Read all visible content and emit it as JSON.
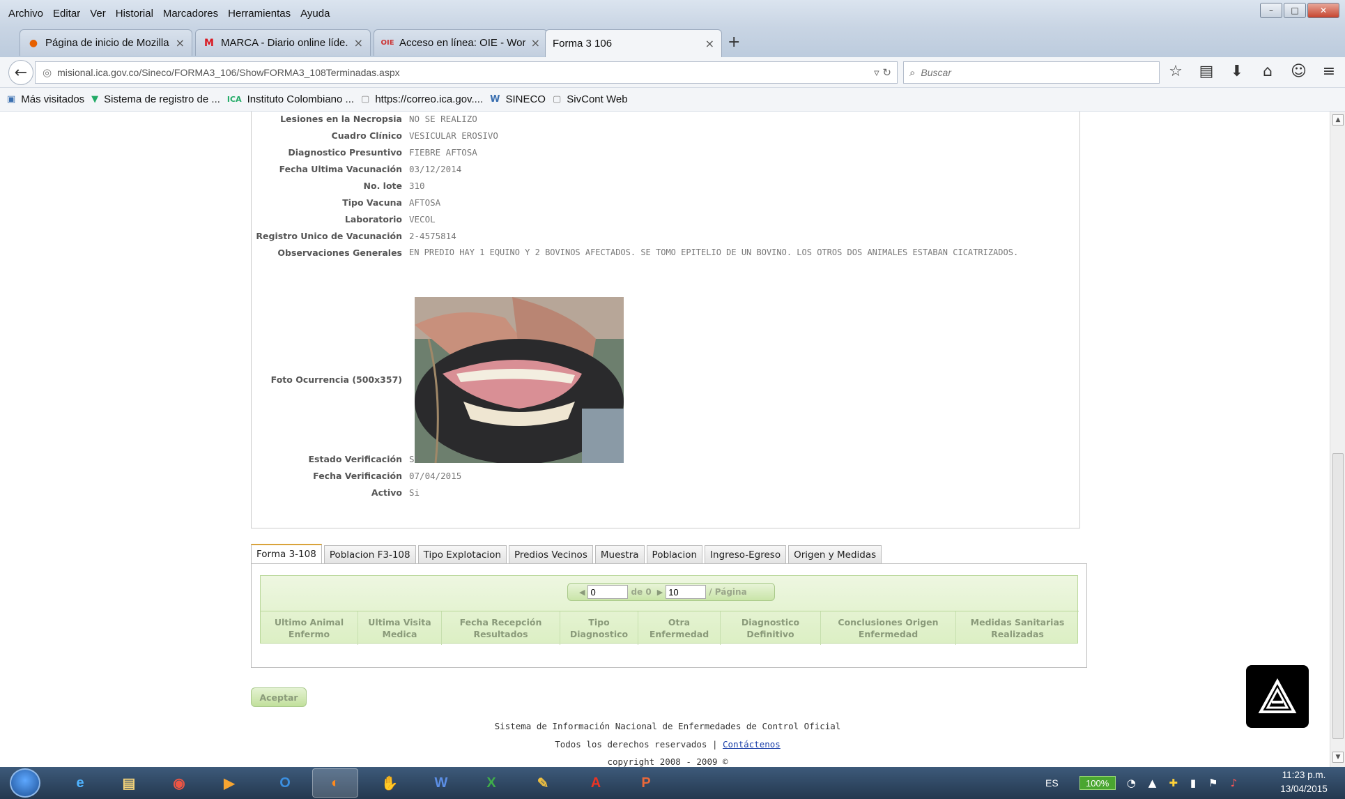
{
  "browser": {
    "menu": [
      "Archivo",
      "Editar",
      "Ver",
      "Historial",
      "Marcadores",
      "Herramientas",
      "Ayuda"
    ],
    "tabs": [
      {
        "title": "Página de inicio de Mozilla...",
        "icon": "firefox-icon"
      },
      {
        "title": "MARCA - Diario online líde...",
        "icon": "marca-icon"
      },
      {
        "title": "Acceso en línea: OIE - Worl...",
        "icon": "oie-icon"
      },
      {
        "title": "Forma 3 106",
        "icon": "page-icon"
      }
    ],
    "url": "misional.ica.gov.co/Sineco/FORMA3_106/ShowFORMA3_108Terminadas.aspx",
    "search_placeholder": "Buscar",
    "bookmarks": [
      {
        "label": "Más visitados",
        "icon": "most-visited-icon"
      },
      {
        "label": "Sistema de registro de ...",
        "icon": "leaf-icon"
      },
      {
        "label": "Instituto Colombiano ...",
        "icon": "ica-icon"
      },
      {
        "label": "https://correo.ica.gov....",
        "icon": "page-icon"
      },
      {
        "label": "SINECO",
        "icon": "sineco-icon"
      },
      {
        "label": "SivCont Web",
        "icon": "page-icon"
      }
    ]
  },
  "detail": {
    "fields": [
      {
        "label": "Lesiones en la Necropsia",
        "value": "NO SE REALIZO"
      },
      {
        "label": "Cuadro Clínico",
        "value": "VESICULAR EROSIVO"
      },
      {
        "label": "Diagnostico Presuntivo",
        "value": "FIEBRE AFTOSA"
      },
      {
        "label": "Fecha Ultima Vacunación",
        "value": "03/12/2014"
      },
      {
        "label": "No. lote",
        "value": "310"
      },
      {
        "label": "Tipo Vacuna",
        "value": "AFTOSA"
      },
      {
        "label": "Laboratorio",
        "value": "VECOL"
      },
      {
        "label": "Registro Unico de Vacunación",
        "value": "2-4575814"
      },
      {
        "label": "Observaciones Generales",
        "value": "EN PREDIO HAY 1 EQUINO Y 2 BOVINOS AFECTADOS. SE TOMO EPITELIO DE UN BOVINO. LOS OTROS DOS ANIMALES ESTABAN CICATRIZADOS."
      }
    ],
    "photo_label": "Foto Ocurrencia (500x357)",
    "fields_after": [
      {
        "label": "Estado Verificación",
        "value": "Si"
      },
      {
        "label": "Fecha Verificación",
        "value": "07/04/2015"
      },
      {
        "label": "Activo",
        "value": "Si"
      }
    ]
  },
  "subtabs": [
    "Forma 3-108",
    "Poblacion F3-108",
    "Tipo Explotacion",
    "Predios Vecinos",
    "Muestra",
    "Poblacion",
    "Ingreso-Egreso",
    "Origen y Medidas"
  ],
  "pager": {
    "page": "0",
    "of_label": "de 0",
    "page_size": "10",
    "per_page_label": "/ Página"
  },
  "grid_columns": [
    "Ultimo Animal Enfermo",
    "Ultima Visita Medica",
    "Fecha Recepción Resultados",
    "Tipo Diagnostico",
    "Otra Enfermedad",
    "Diagnostico Definitivo",
    "Conclusiones Origen Enfermedad",
    "Medidas Sanitarias Realizadas"
  ],
  "accept_label": "Aceptar",
  "footer": {
    "line1": "Sistema de Información Nacional de Enfermedades de Control Oficial",
    "line2_prefix": "Todos los derechos reservados |",
    "contact_link": "Contáctenos",
    "line3": "copyright 2008 - 2009 ©"
  },
  "taskbar": {
    "apps": [
      "start-orb",
      "internet-explorer-icon",
      "file-explorer-icon",
      "chrome-icon",
      "media-player-icon",
      "outlook-icon",
      "firefox-icon",
      "hand-icon",
      "word-icon",
      "excel-icon",
      "paint-icon",
      "acrobat-icon",
      "powerpoint-icon"
    ],
    "language": "ES",
    "battery": "100%",
    "time": "11:23 p.m.",
    "date": "13/04/2015"
  },
  "colors": {
    "accent_green": "#dcefc4",
    "active_tab_border": "#d9a33a",
    "link": "#1a3fa8"
  }
}
